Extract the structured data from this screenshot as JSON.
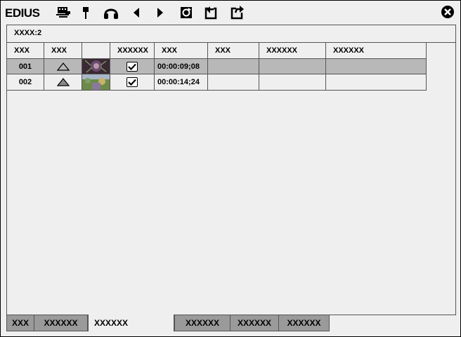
{
  "app": {
    "logo": "EDIUS"
  },
  "toolbar": {
    "icons": [
      "clip-marker-icon",
      "marker-icon",
      "headphones-icon",
      "prev-icon",
      "next-icon",
      "refresh-icon",
      "import-icon",
      "export-icon"
    ]
  },
  "count": "XXXX:2",
  "table": {
    "headers": [
      "XXX",
      "XXX",
      "",
      "XXXXXX",
      "XXX",
      "XXX",
      "XXXXXX",
      "XXXXXX"
    ],
    "rows": [
      {
        "no": "001",
        "type_icon": "triangle-outline-icon",
        "thumb": "flower-thumbnail",
        "checked": true,
        "duration": "00:00:09;08",
        "selected": true
      },
      {
        "no": "002",
        "type_icon": "triangle-filled-icon",
        "thumb": "garden-thumbnail",
        "checked": true,
        "duration": "00:00:14;24",
        "selected": false
      }
    ]
  },
  "tabs": [
    "XXX",
    "XXXXXX",
    "XXXXXX",
    "XXXXXX",
    "XXXXXX",
    "XXXXXX"
  ],
  "active_tab_index": 2,
  "colors": {
    "selected_row": "#b8b8b8",
    "tab_inactive": "#9a9a9a",
    "background": "#efefef"
  }
}
